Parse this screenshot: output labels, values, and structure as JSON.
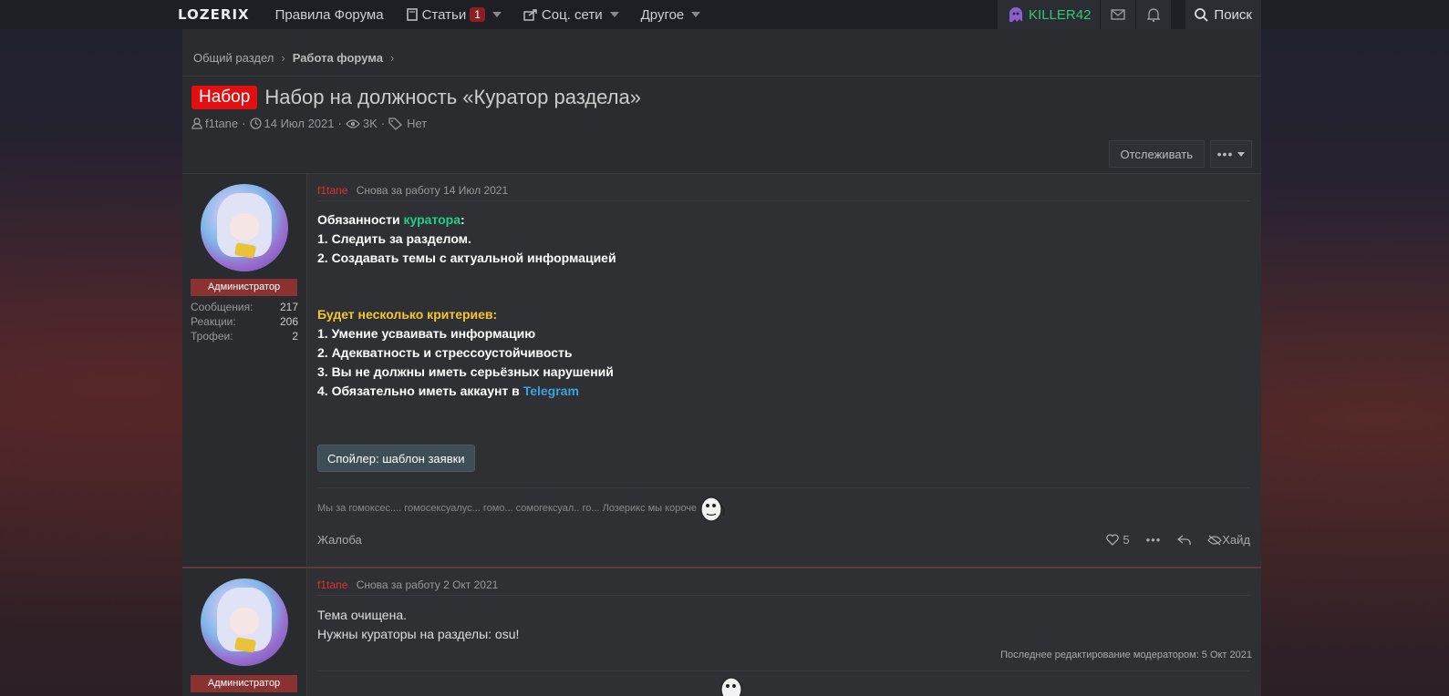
{
  "nav": {
    "logo": "LOZERIX",
    "rules": "Правила Форума",
    "articles": "Статьи",
    "articles_badge": "1",
    "social": "Соц. сети",
    "other": "Другое",
    "username": "KILLER42",
    "search": "Поиск"
  },
  "breadcrumb": {
    "item1": "Общий раздел",
    "item2": "Работа форума"
  },
  "thread": {
    "prefix": "Набор",
    "title": "Набор на должность «Куратор раздела»",
    "author": "f1tane",
    "date": "14 Июл 2021",
    "views": "3K",
    "tags": "Нет",
    "watch": "Отслеживать"
  },
  "post1": {
    "author": "f1tane",
    "status": "Снова за работу",
    "date": "14 Июл 2021",
    "role": "Администратор",
    "stats": {
      "messages_label": "Сообщения:",
      "messages": "217",
      "reactions_label": "Реакции:",
      "reactions": "206",
      "trophies_label": "Трофеи:",
      "trophies": "2"
    },
    "l1a": "Обязанности ",
    "l1b": "куратора",
    "l1c": ":",
    "l2": "1. Следить за разделом.",
    "l3": "2. Создавать темы с актуальной информацией",
    "l4": "Будет несколько критериев:",
    "l5": "1. Умение усваивать информацию",
    "l6": "2. Адекватность и стрессоустойчивость",
    "l7": "3. Вы не должны иметь серьёзных нарушений",
    "l8a": "4. Обязательно иметь аккаунт в ",
    "l8b": "Telegram",
    "spoiler": "Спойлер: шаблон заявки",
    "signature": "Мы за гомоксес.... гомосексуалус... гомо... сомогексуал.. го... Лозерикс мы короче",
    "report": "Жалоба",
    "likes": "5",
    "hide": "Хайд"
  },
  "post2": {
    "author": "f1tane",
    "status": "Снова за работу",
    "date": "2 Окт 2021",
    "role": "Администратор",
    "l1": "Тема очищена.",
    "l2": "Нужны кураторы на разделы: osu!",
    "edited": "Последнее редактирование модератором: 5 Окт 2021"
  }
}
